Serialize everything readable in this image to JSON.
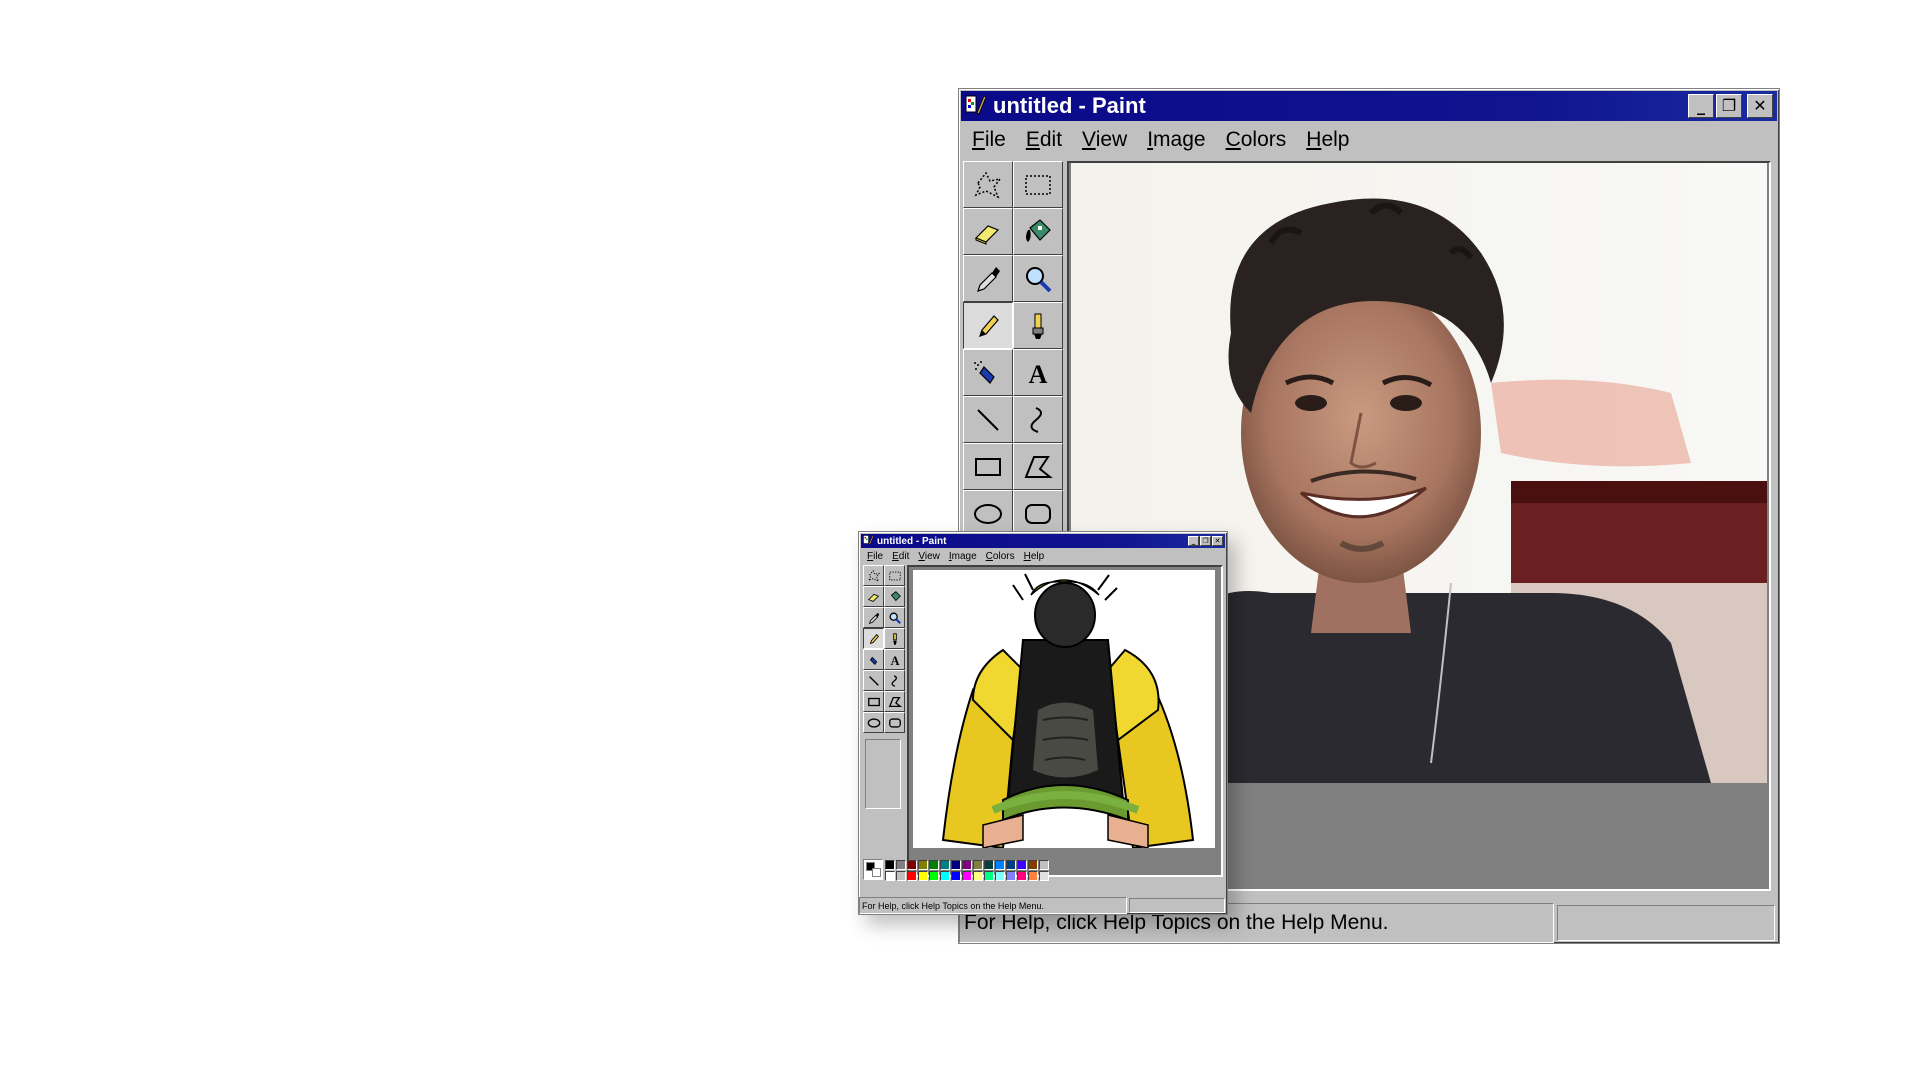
{
  "big_window": {
    "title": "untitled - Paint",
    "controls": {
      "minimize": "_",
      "maximize": "❐",
      "close": "✕"
    },
    "menu": [
      {
        "key": "F",
        "rest": "ile"
      },
      {
        "key": "E",
        "rest": "dit"
      },
      {
        "key": "V",
        "rest": "iew"
      },
      {
        "key": "I",
        "rest": "mage"
      },
      {
        "key": "C",
        "rest": "olors"
      },
      {
        "key": "H",
        "rest": "elp"
      }
    ],
    "tools": [
      "free-select",
      "rect-select",
      "eraser",
      "fill",
      "color-picker",
      "magnifier",
      "pencil",
      "brush",
      "airbrush",
      "text",
      "line",
      "curve",
      "rectangle",
      "polygon",
      "ellipse",
      "rounded-rectangle"
    ],
    "active_tool": "pencil",
    "canvas_image": "photo-of-smiling-young-man-with-curly-hair",
    "palette_colors": [
      "#8c2a8c",
      "#7f7f5f",
      "#003f3f",
      "#0080ff",
      "#00408a",
      "#1e1ee6",
      "#8a3030",
      "#ff40ff",
      "#ffff80",
      "#00ff80",
      "#80ffff",
      "#8080ff",
      "#ff0080",
      "#ff8040"
    ],
    "status_text": "For Help, click Help Topics on the Help Menu."
  },
  "small_window": {
    "title": "untitled - Paint",
    "controls": {
      "minimize": "_",
      "maximize": "❐",
      "close": "✕"
    },
    "menu": [
      {
        "key": "F",
        "rest": "ile"
      },
      {
        "key": "E",
        "rest": "dit"
      },
      {
        "key": "V",
        "rest": "iew"
      },
      {
        "key": "I",
        "rest": "mage"
      },
      {
        "key": "C",
        "rest": "olors"
      },
      {
        "key": "H",
        "rest": "elp"
      }
    ],
    "active_tool": "pencil",
    "canvas_image": "anime-character-in-yellow-jacket",
    "palette_colors": [
      "#000000",
      "#808080",
      "#800000",
      "#808000",
      "#008000",
      "#008080",
      "#000080",
      "#800080",
      "#808040",
      "#004040",
      "#0080ff",
      "#004080",
      "#4000ff",
      "#804000",
      "#c0c0c0",
      "#ffffff",
      "#c0c0c0",
      "#ff0000",
      "#ffff00",
      "#00ff00",
      "#00ffff",
      "#0000ff",
      "#ff00ff",
      "#ffff80",
      "#00ff80",
      "#80ffff",
      "#8080ff",
      "#ff0080",
      "#ff8040",
      "#e0e0e0"
    ],
    "status_text": "For Help, click Help Topics on the Help Menu."
  }
}
